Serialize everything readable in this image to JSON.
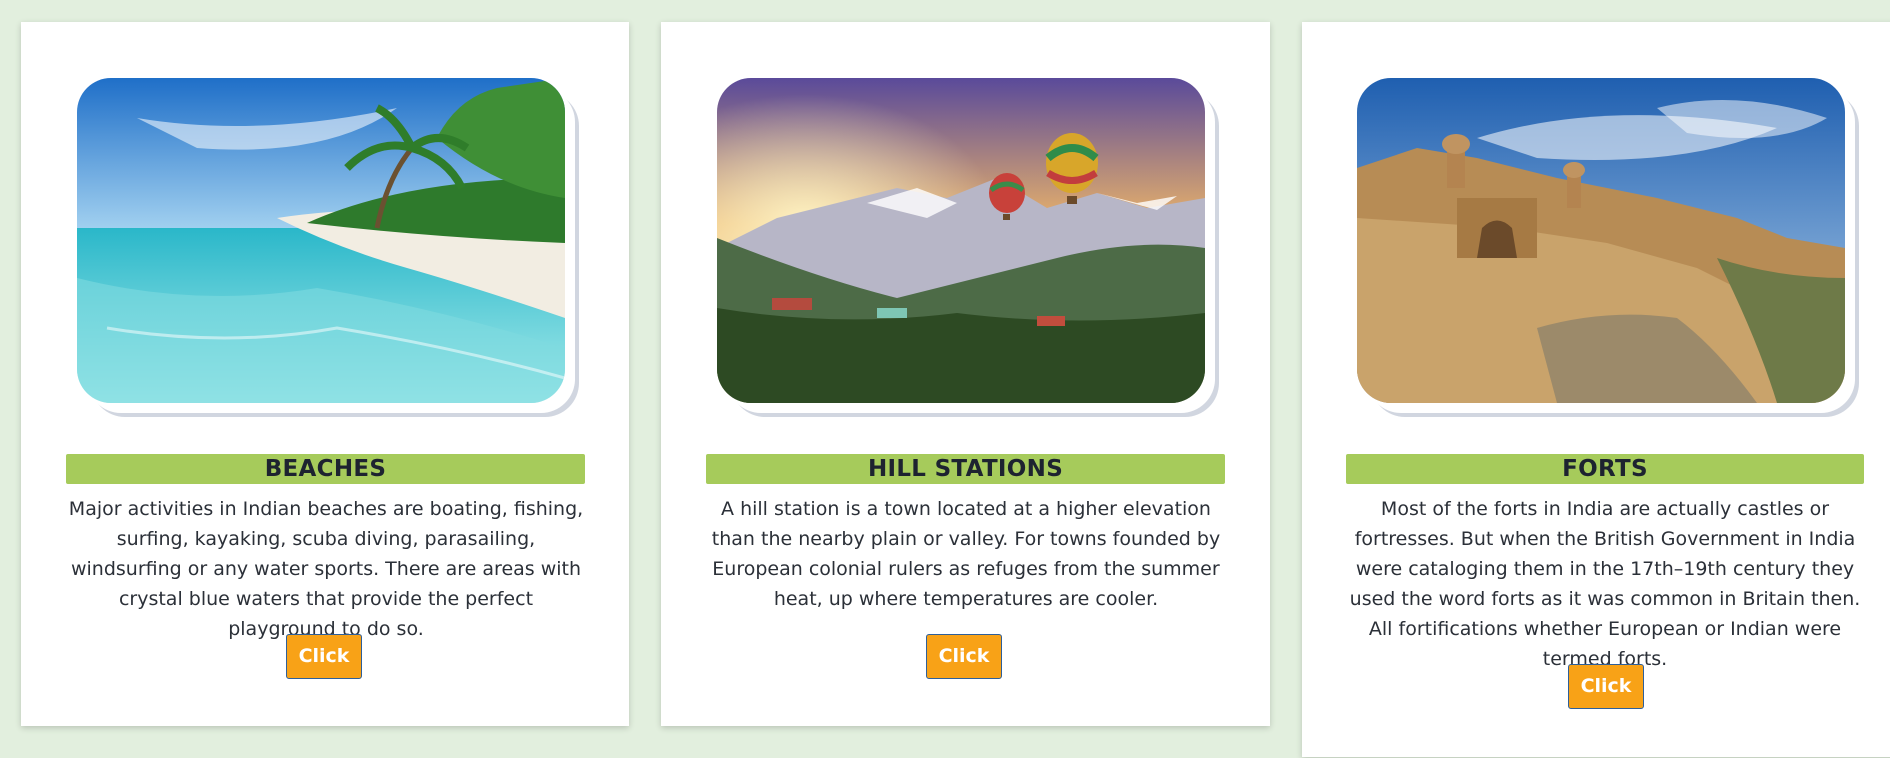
{
  "cards": [
    {
      "title": "BEACHES",
      "image_alt": "Tropical beach with palm trees and turquoise water",
      "description": "Major activities in Indian beaches are boating, fishing, surfing, kayaking, scuba diving, parasailing, windsurfing or any water sports. There are areas with crystal blue waters that provide the perfect playground to do so.",
      "button_label": "Click"
    },
    {
      "title": "HILL STATIONS",
      "image_alt": "Mountain valley with hot air balloons at sunrise",
      "description": "A hill station is a town located at a higher elevation than the nearby plain or valley. For towns founded by European colonial rulers as refuges from the summer heat, up where temperatures are cooler.",
      "button_label": "Click"
    },
    {
      "title": "FORTS",
      "image_alt": "Sandstone fort on a hill under a blue sky",
      "description": "Most of the forts in India are actually castles or fortresses. But when the British Government in India were cataloging them in the 17th–19th century they used the word forts as it was common in Britain then. All fortifications whether European or Indian were termed forts.",
      "button_label": "Click"
    }
  ],
  "colors": {
    "page_background": "#e2efde",
    "title_bar": "#a6cb5b",
    "button": "#f8a217",
    "button_border": "#2e5f9a"
  }
}
